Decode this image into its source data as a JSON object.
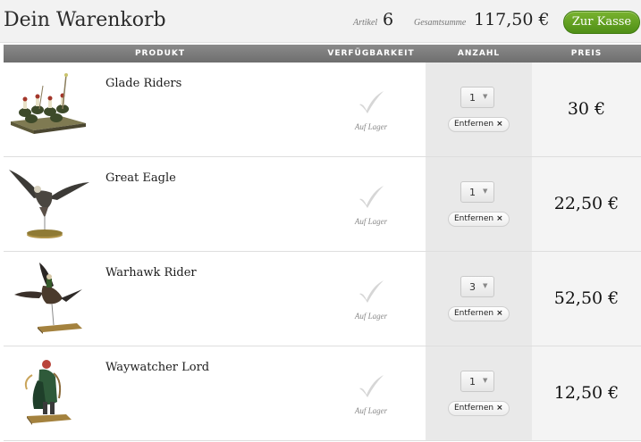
{
  "header": {
    "title": "Dein Warenkorb",
    "articles_label": "Artikel",
    "articles_count": "6",
    "total_label": "Gesamtsumme",
    "total_value": "117,50 €",
    "checkout_label": "Zur Kasse"
  },
  "table": {
    "headers": {
      "product": "PRODUKT",
      "availability": "VERFÜGBARKEIT",
      "quantity": "ANZAHL",
      "price": "PREIS"
    },
    "rows": [
      {
        "name": "Glade Riders",
        "availability": "Auf Lager",
        "quantity": "1",
        "remove_label": "Entfernen",
        "price": "30 €",
        "thumbnail": "glade-riders-miniature-image"
      },
      {
        "name": "Great Eagle",
        "availability": "Auf Lager",
        "quantity": "1",
        "remove_label": "Entfernen",
        "price": "22,50 €",
        "thumbnail": "great-eagle-miniature-image"
      },
      {
        "name": "Warhawk Rider",
        "availability": "Auf Lager",
        "quantity": "3",
        "remove_label": "Entfernen",
        "price": "52,50 €",
        "thumbnail": "warhawk-rider-miniature-image"
      },
      {
        "name": "Waywatcher Lord",
        "availability": "Auf Lager",
        "quantity": "1",
        "remove_label": "Entfernen",
        "price": "12,50 €",
        "thumbnail": "waywatcher-lord-miniature-image"
      }
    ]
  },
  "icons": {
    "availability": "checkmark-icon",
    "remove": "close-icon",
    "select": "chevron-down-icon"
  },
  "colors": {
    "checkout_button": "#5e9c1f",
    "table_header": "#7c7c7c",
    "quantity_column": "#e9e9e9",
    "price_column": "#f4f4f4"
  }
}
